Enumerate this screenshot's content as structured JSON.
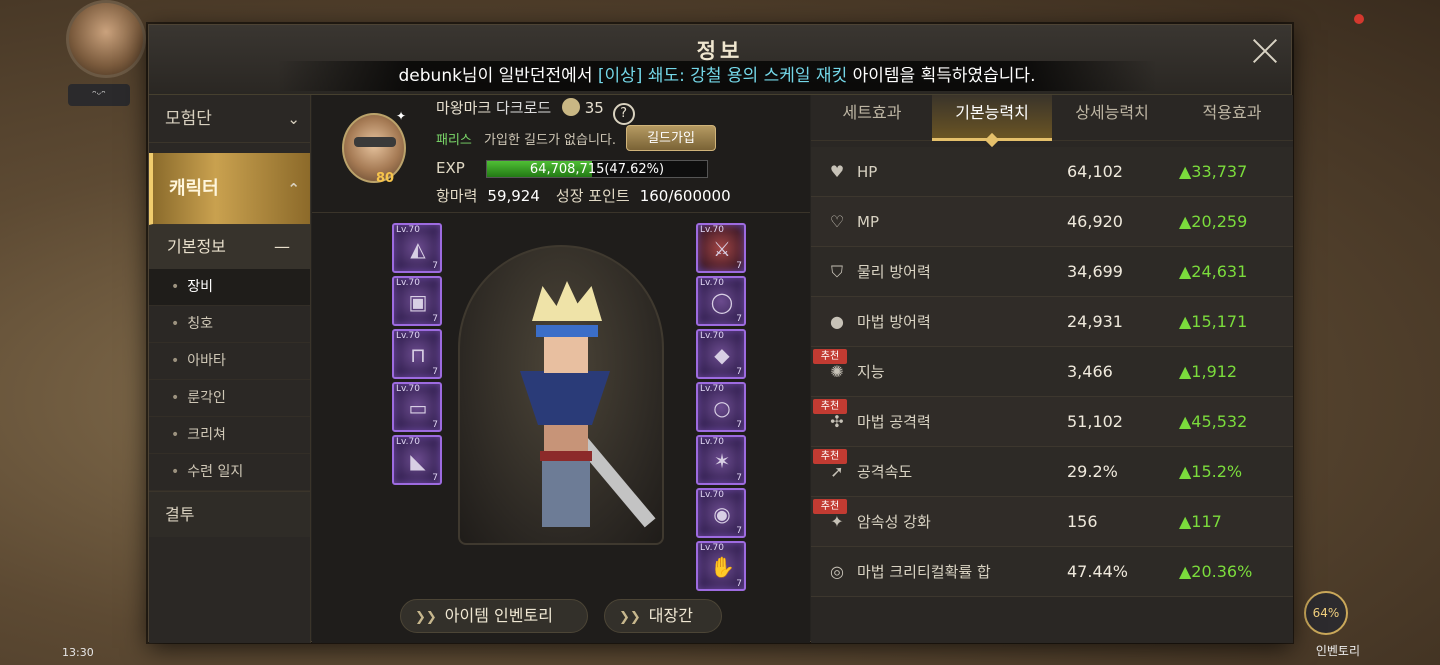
{
  "title": "정보",
  "notice": {
    "prefix": "debunk님이 일반던전에서 ",
    "item": "[이상] 쇄도: 강철 용의 스케일 재킷",
    "suffix": " 아이템을 획득하였습니다."
  },
  "sidebar": {
    "groups": [
      {
        "label": "모험단"
      },
      {
        "label": "캐릭터"
      }
    ],
    "sub": "기본정보",
    "items": [
      {
        "label": "장비",
        "active": true
      },
      {
        "label": "칭호"
      },
      {
        "label": "아바타"
      },
      {
        "label": "룬각인"
      },
      {
        "label": "크리쳐"
      },
      {
        "label": "수련 일지"
      }
    ],
    "last": "결투"
  },
  "profile": {
    "level": "80",
    "name": "마왕마크",
    "class": "다크로드",
    "fame_level": "35",
    "server": "패리스",
    "guild_status": "가입한 길드가 없습니다.",
    "guild_button": "길드가입",
    "exp_label": "EXP",
    "exp_text": "64,708,715(47.62%)",
    "exp_fraction": 0.4762,
    "power_label": "항마력",
    "power_value": "59,924",
    "growth_label": "성장 포인트",
    "growth_value": "160/600000"
  },
  "equipment": {
    "left": [
      {
        "lv": "Lv.70",
        "q": "7",
        "icon": "shoulder-icon"
      },
      {
        "lv": "Lv.70",
        "q": "7",
        "icon": "top-armor-icon"
      },
      {
        "lv": "Lv.70",
        "q": "7",
        "icon": "pants-icon"
      },
      {
        "lv": "Lv.70",
        "q": "7",
        "icon": "belt-icon"
      },
      {
        "lv": "Lv.70",
        "q": "7",
        "icon": "boots-icon"
      }
    ],
    "right": [
      {
        "lv": "Lv.70",
        "q": "7",
        "icon": "weapon-icon"
      },
      {
        "lv": "Lv.70",
        "q": "7",
        "icon": "bracelet-icon"
      },
      {
        "lv": "Lv.70",
        "q": "7",
        "icon": "necklace-icon"
      },
      {
        "lv": "Lv.70",
        "q": "7",
        "icon": "ring-icon"
      },
      {
        "lv": "Lv.70",
        "q": "7",
        "icon": "support-icon"
      },
      {
        "lv": "Lv.70",
        "q": "7",
        "icon": "magic-stone-icon"
      },
      {
        "lv": "Lv.70",
        "q": "7",
        "icon": "earring-icon"
      }
    ]
  },
  "buttons": {
    "inventory": "아이템 인벤토리",
    "hall": "대장간"
  },
  "tabs": [
    "세트효과",
    "기본능력치",
    "상세능력치",
    "적용효과"
  ],
  "active_tab": 1,
  "stats": [
    {
      "name": "HP",
      "value": "64,102",
      "inc": "▲33,737",
      "icon": "heart-icon",
      "rec": ""
    },
    {
      "name": "MP",
      "value": "46,920",
      "inc": "▲20,259",
      "icon": "heart-outline-icon",
      "rec": ""
    },
    {
      "name": "물리 방어력",
      "value": "34,699",
      "inc": "▲24,631",
      "icon": "shield-icon",
      "rec": ""
    },
    {
      "name": "마법 방어력",
      "value": "24,931",
      "inc": "▲15,171",
      "icon": "orb-icon",
      "rec": ""
    },
    {
      "name": "지능",
      "value": "3,466",
      "inc": "▲1,912",
      "icon": "brain-icon",
      "rec": "추천"
    },
    {
      "name": "마법 공격력",
      "value": "51,102",
      "inc": "▲45,532",
      "icon": "magic-attack-icon",
      "rec": "추천"
    },
    {
      "name": "공격속도",
      "value": "29.2%",
      "inc": "▲15.2%",
      "icon": "attack-speed-icon",
      "rec": "추천"
    },
    {
      "name": "암속성 강화",
      "value": "156",
      "inc": "▲117",
      "icon": "dark-element-icon",
      "rec": "추천"
    },
    {
      "name": "마법 크리티컬확률 합",
      "value": "47.44%",
      "inc": "▲20.36%",
      "icon": "critical-icon",
      "rec": ""
    }
  ],
  "background": {
    "clock": "13:30",
    "badge": "64%",
    "badge_label": "인벤토리"
  }
}
